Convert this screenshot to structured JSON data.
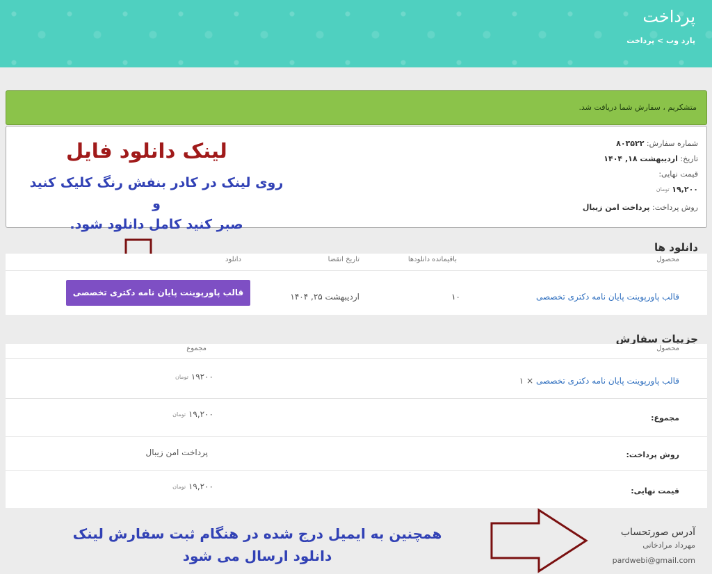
{
  "header": {
    "title": "پرداخت",
    "breadcrumb": "پارد وب > پرداخت"
  },
  "notice": "متشکریم ، سفارش شما دریافت شد.",
  "order": {
    "number_label": "شماره سفارش:",
    "number_value": "۸۰۳۵۲۲",
    "date_label": "تاریخ:",
    "date_value": "اردیبهشت ۱۸, ۱۴۰۴",
    "total_label": "قیمت نهایی:",
    "total_value": "۱۹,۲۰۰",
    "currency": "تومان",
    "payment_label": "روش پرداخت:",
    "payment_value": "پرداخت امن زیبال"
  },
  "annotations": {
    "title": "لینک دانلود فایل",
    "sub_line1": "روی لینک در کادر بنفش رنگ کلیک کنید و",
    "sub_line2": "صبر کنید کامل دانلود شود.",
    "bottom_line1": "همچنین به ایمیل درج شده در هنگام ثبت سفارش لینک",
    "bottom_line2": "دانلود ارسال می شود"
  },
  "downloads": {
    "title": "دانلود ها",
    "columns": [
      "محصول",
      "باقیمانده دانلودها",
      "تاریخ انقضا",
      "دانلود"
    ],
    "row": {
      "product": "قالب پاورپوینت پایان نامه دکتری تخصصی",
      "remaining": "۱۰",
      "expiry": "اردیبهشت ۲۵, ۱۴۰۴",
      "button": "قالب پاورپوینت پایان نامه دکتری تخصصی"
    }
  },
  "details": {
    "title": "جزییات سفارش",
    "columns": [
      "محصول",
      "مجموع"
    ],
    "item_product": "قالب پاورپوینت پایان نامه دکتری تخصصی",
    "item_qty": "× ۱",
    "item_total": "۱۹۲۰۰",
    "subtotal_label": "مجموع:",
    "subtotal_value": "۱۹,۲۰۰",
    "payment_label": "روش پرداخت:",
    "payment_value": "پرداخت امن زیبال",
    "total_label": "قیمت نهایی:",
    "total_value": "۱۹,۲۰۰",
    "currency": "تومان"
  },
  "billing": {
    "title": "آدرس صورتحساب",
    "name": "مهرداد مرادخانی",
    "email": "pardwebi@gmail.com"
  },
  "colors": {
    "hero": "#4fd0c0",
    "notice": "#8bc34a",
    "button": "#7e4fc4",
    "annotation_red": "#a01a1a",
    "annotation_blue": "#3141b5"
  }
}
